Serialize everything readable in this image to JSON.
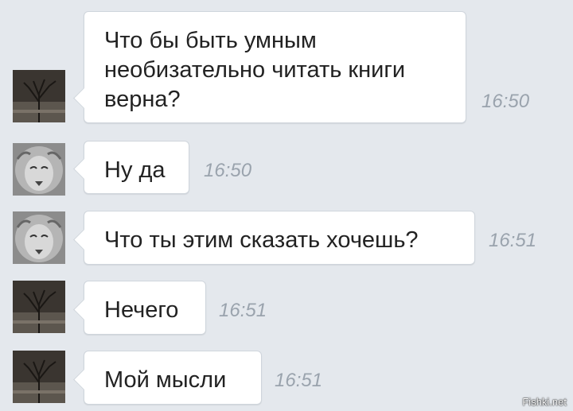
{
  "messages": [
    {
      "avatar": "avatar-dark-tree",
      "text": "Что бы быть умным\nнеобизательно читать книги\nверна?",
      "time": "16:50"
    },
    {
      "avatar": "avatar-lion",
      "text": "Ну да",
      "time": "16:50"
    },
    {
      "avatar": "avatar-lion",
      "text": "Что ты этим сказать хочешь?",
      "time": "16:51"
    },
    {
      "avatar": "avatar-dark-tree",
      "text": "Нечего",
      "time": "16:51"
    },
    {
      "avatar": "avatar-dark-tree",
      "text": "Мой мысли",
      "time": "16:51"
    }
  ],
  "watermark": "Fishki.net",
  "colors": {
    "background": "#e4e8ed",
    "bubble": "#ffffff",
    "time": "#9aa3ad"
  }
}
